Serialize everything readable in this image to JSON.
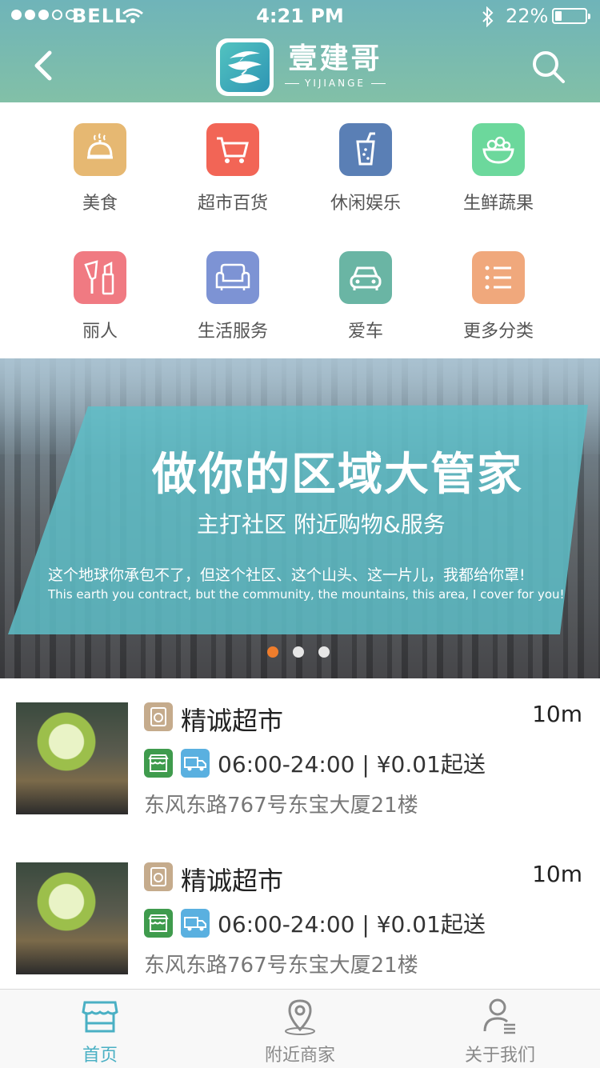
{
  "status_bar": {
    "carrier": "BELL",
    "time": "4:21 PM",
    "battery_percent": "22%",
    "battery_level": 0.22,
    "signal_dots_filled": 3,
    "signal_dots_total": 5
  },
  "header": {
    "brand_cn": "壹建哥",
    "brand_en": "YIJIANGE",
    "back_icon": "chevron-left-icon",
    "search_icon": "search-icon"
  },
  "categories": [
    {
      "label": "美食",
      "icon": "food-cloche-icon",
      "color": "#e6b872"
    },
    {
      "label": "超市百货",
      "icon": "shopping-cart-icon",
      "color": "#f26556"
    },
    {
      "label": "休闲娱乐",
      "icon": "drink-cup-icon",
      "color": "#5a7fb5"
    },
    {
      "label": "生鲜蔬果",
      "icon": "salad-bowl-icon",
      "color": "#6cd89c"
    },
    {
      "label": "丽人",
      "icon": "cosmetics-icon",
      "color": "#f07a82"
    },
    {
      "label": "生活服务",
      "icon": "sofa-icon",
      "color": "#7d93d4"
    },
    {
      "label": "爱车",
      "icon": "car-icon",
      "color": "#6ab5a4"
    },
    {
      "label": "更多分类",
      "icon": "list-icon",
      "color": "#f0a87c"
    }
  ],
  "banner": {
    "title": "做你的区域大管家",
    "subtitle": "主打社区  附近购物&服务",
    "tagline_cn": "这个地球你承包不了，但这个社区、这个山头、这一片儿，我都给你罩!",
    "tagline_en": "This earth you contract, but the community, the mountains, this area, I cover for you!",
    "page_count": 3,
    "active_page": 1
  },
  "shops": [
    {
      "name": "精诚超市",
      "distance": "10m",
      "hours": "06:00-24:00  |  ¥0.01起送",
      "address": "东风东路767号东宝大厦21楼"
    },
    {
      "name": "精诚超市",
      "distance": "10m",
      "hours": "06:00-24:00  |  ¥0.01起送",
      "address": "东风东路767号东宝大厦21楼"
    }
  ],
  "tabbar": {
    "items": [
      {
        "label": "首页",
        "icon": "storefront-icon",
        "active": true
      },
      {
        "label": "附近商家",
        "icon": "location-pin-icon",
        "active": false
      },
      {
        "label": "关于我们",
        "icon": "user-profile-icon",
        "active": false
      }
    ],
    "active_color": "#4ab0c4",
    "inactive_color": "#8a8a8a"
  }
}
